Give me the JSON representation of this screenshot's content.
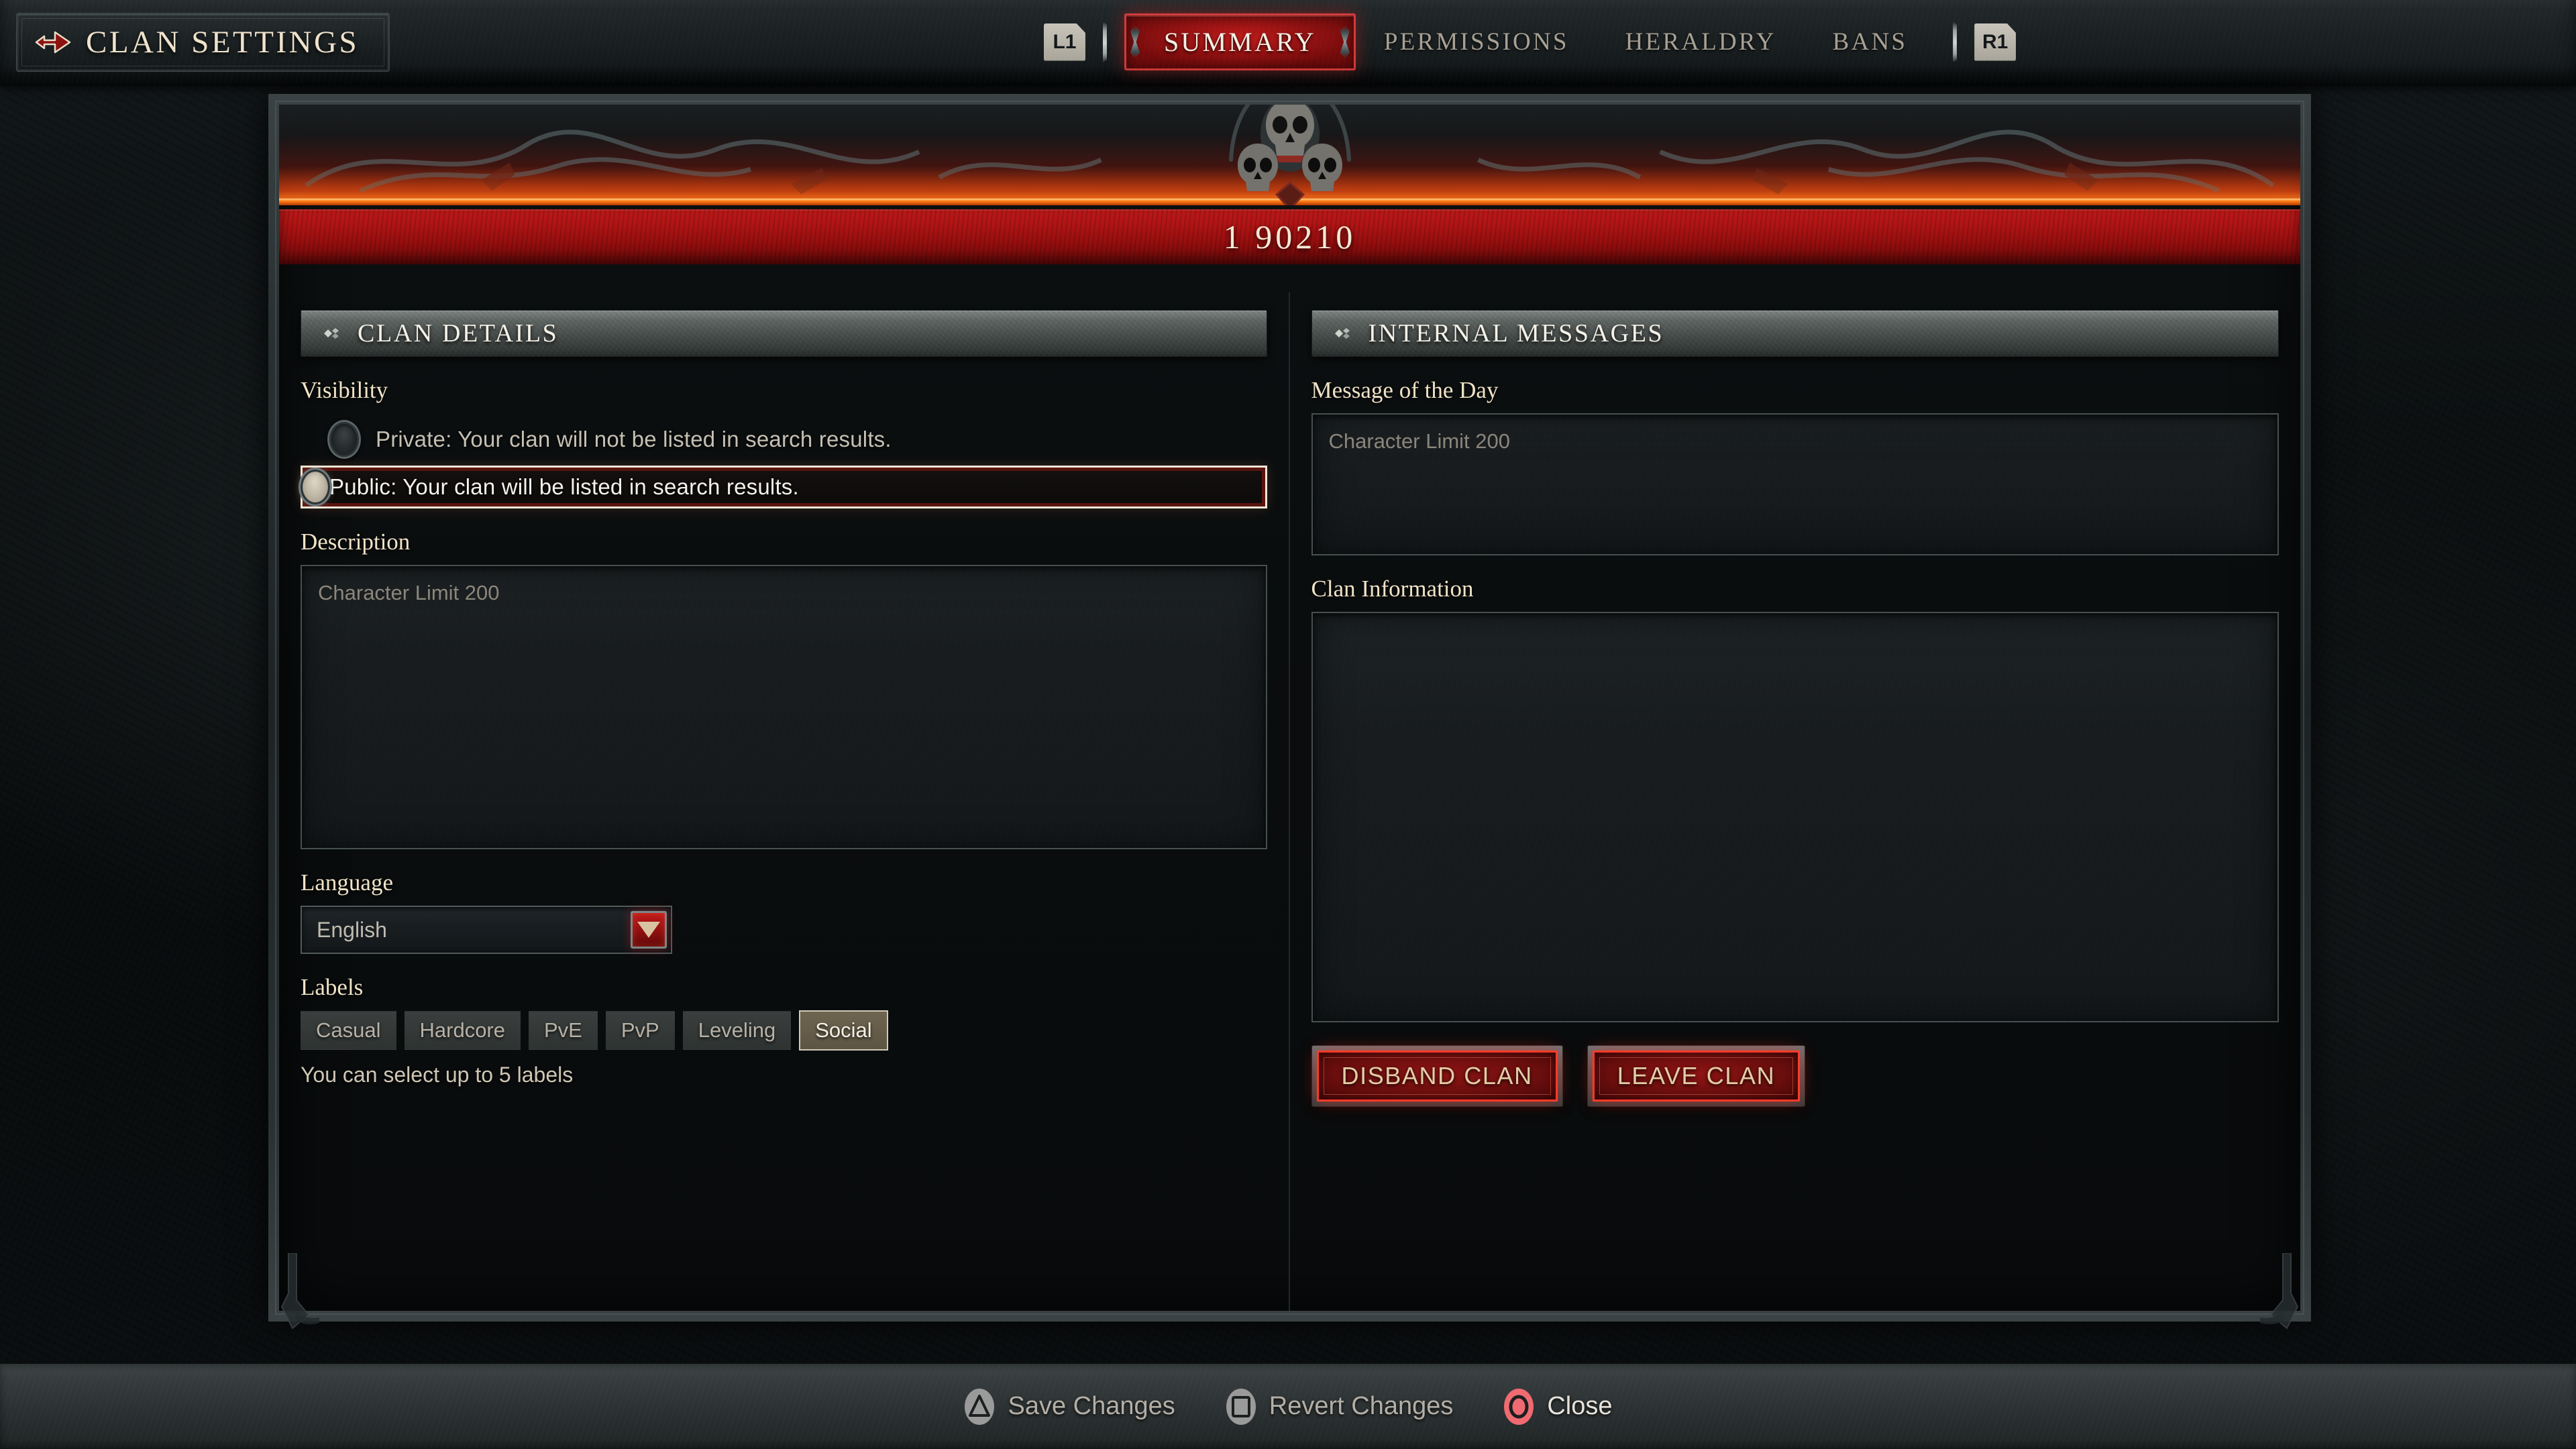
{
  "header": {
    "arrow_icon": "arrow-right-icon",
    "title": "CLAN SETTINGS",
    "left_bumper": "L1",
    "right_bumper": "R1",
    "tabs": [
      {
        "label": "SUMMARY",
        "active": true
      },
      {
        "label": "PERMISSIONS",
        "active": false
      },
      {
        "label": "HERALDRY",
        "active": false
      },
      {
        "label": "BANS",
        "active": false
      }
    ]
  },
  "banner": {
    "ornament_icon": "skull-trio-scythes-icon",
    "clan_name": "1 90210"
  },
  "left_panel": {
    "ornament_icon": "diamond-ornament-icon",
    "title": "CLAN DETAILS",
    "visibility": {
      "label": "Visibility",
      "options": [
        {
          "label": "Private: Your clan will not be listed in search results.",
          "selected": false
        },
        {
          "label": "Public: Your clan will be listed in search results.",
          "selected": true
        }
      ]
    },
    "description": {
      "label": "Description",
      "value": "",
      "placeholder": "Character Limit 200"
    },
    "language": {
      "label": "Language",
      "value": "English",
      "dropdown_icon": "chevron-down-icon"
    },
    "labels": {
      "label": "Labels",
      "chips": [
        {
          "text": "Casual",
          "selected": false
        },
        {
          "text": "Hardcore",
          "selected": false
        },
        {
          "text": "PvE",
          "selected": false
        },
        {
          "text": "PvP",
          "selected": false
        },
        {
          "text": "Leveling",
          "selected": false
        },
        {
          "text": "Social",
          "selected": true
        }
      ],
      "help": "You can select up to 5 labels"
    }
  },
  "right_panel": {
    "ornament_icon": "diamond-ornament-icon",
    "title": "INTERNAL MESSAGES",
    "motd": {
      "label": "Message of the Day",
      "value": "",
      "placeholder": "Character Limit 200"
    },
    "clan_information": {
      "label": "Clan Information",
      "value": ""
    },
    "actions": [
      {
        "label": "DISBAND CLAN",
        "name": "disband-clan-button"
      },
      {
        "label": "LEAVE CLAN",
        "name": "leave-clan-button"
      }
    ]
  },
  "footer": {
    "actions": [
      {
        "glyph": "playstation-triangle-icon",
        "label": "Save Changes"
      },
      {
        "glyph": "playstation-square-icon",
        "label": "Revert Changes"
      },
      {
        "glyph": "playstation-circle-icon",
        "label": "Close"
      }
    ]
  },
  "colors": {
    "accent_red": "#c11a1a",
    "danger_border": "#ff3a2a",
    "parchment": "#f0e3c6",
    "muted_text": "#b7b1a6",
    "lava": "#ff7a14"
  }
}
